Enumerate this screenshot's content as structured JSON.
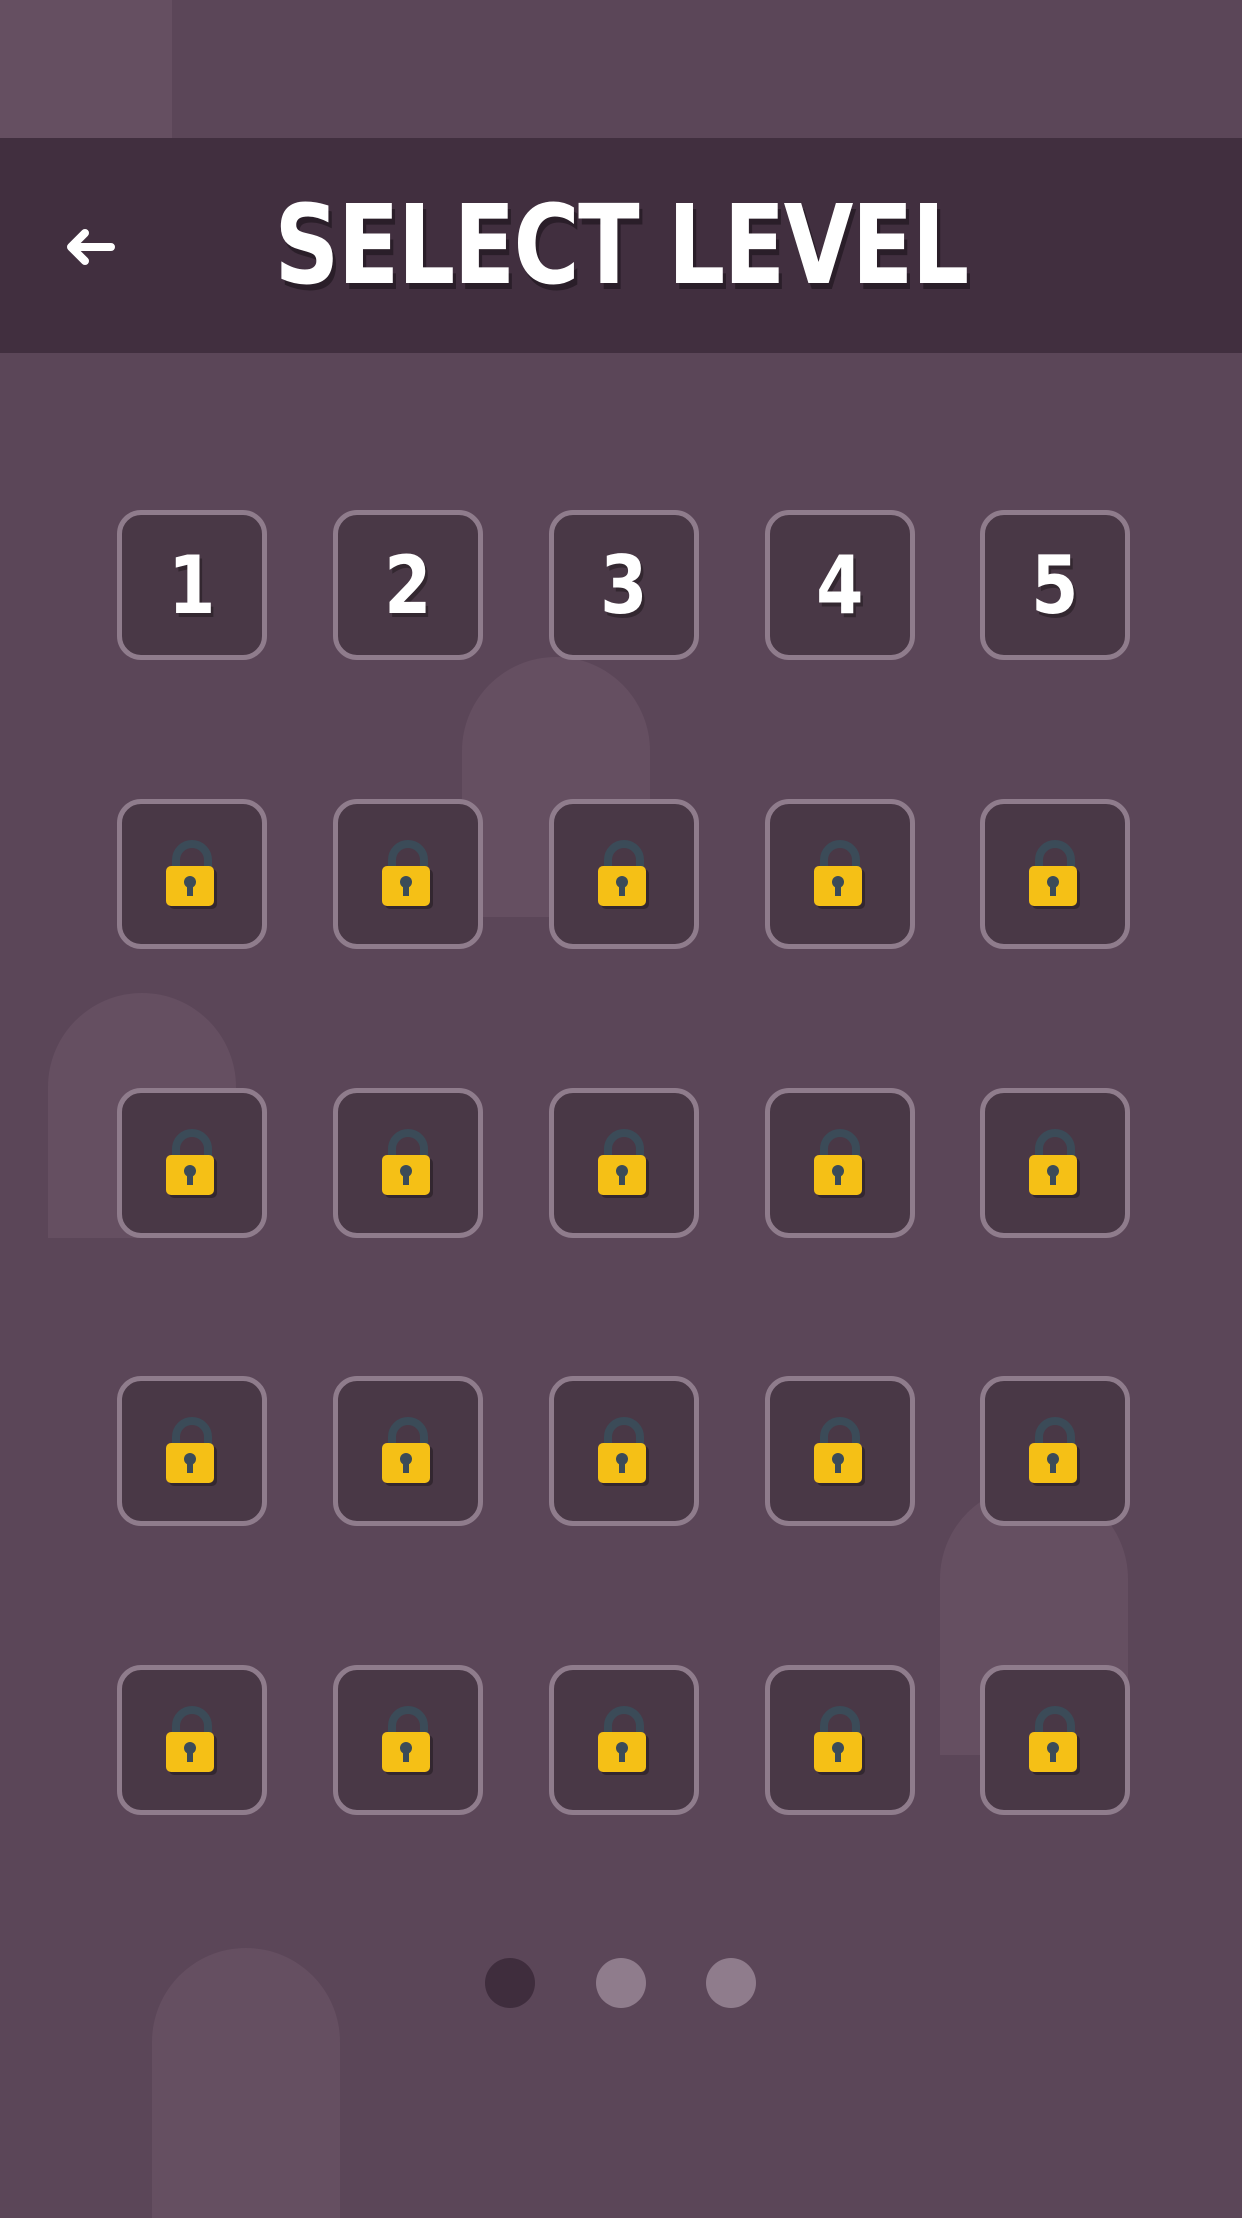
{
  "header": {
    "title": "SELECT LEVEL",
    "back_icon": "arrow-left-icon"
  },
  "colors": {
    "background": "#5b4658",
    "header": "#412f3f",
    "tile_fill": "#493846",
    "tile_border": "#8f7c8c",
    "lock_body": "#f5c016",
    "lock_shackle": "#3b4b58",
    "dot_active": "#3f2d3d",
    "dot_inactive": "#8f7c8c"
  },
  "levels": [
    {
      "label": "1",
      "locked": false
    },
    {
      "label": "2",
      "locked": false
    },
    {
      "label": "3",
      "locked": false
    },
    {
      "label": "4",
      "locked": false
    },
    {
      "label": "5",
      "locked": false
    },
    {
      "label": "",
      "locked": true
    },
    {
      "label": "",
      "locked": true
    },
    {
      "label": "",
      "locked": true
    },
    {
      "label": "",
      "locked": true
    },
    {
      "label": "",
      "locked": true
    },
    {
      "label": "",
      "locked": true
    },
    {
      "label": "",
      "locked": true
    },
    {
      "label": "",
      "locked": true
    },
    {
      "label": "",
      "locked": true
    },
    {
      "label": "",
      "locked": true
    },
    {
      "label": "",
      "locked": true
    },
    {
      "label": "",
      "locked": true
    },
    {
      "label": "",
      "locked": true
    },
    {
      "label": "",
      "locked": true
    },
    {
      "label": "",
      "locked": true
    },
    {
      "label": "",
      "locked": true
    },
    {
      "label": "",
      "locked": true
    },
    {
      "label": "",
      "locked": true
    },
    {
      "label": "",
      "locked": true
    },
    {
      "label": "",
      "locked": true
    }
  ],
  "pagination": {
    "pages": 3,
    "current": 1
  }
}
